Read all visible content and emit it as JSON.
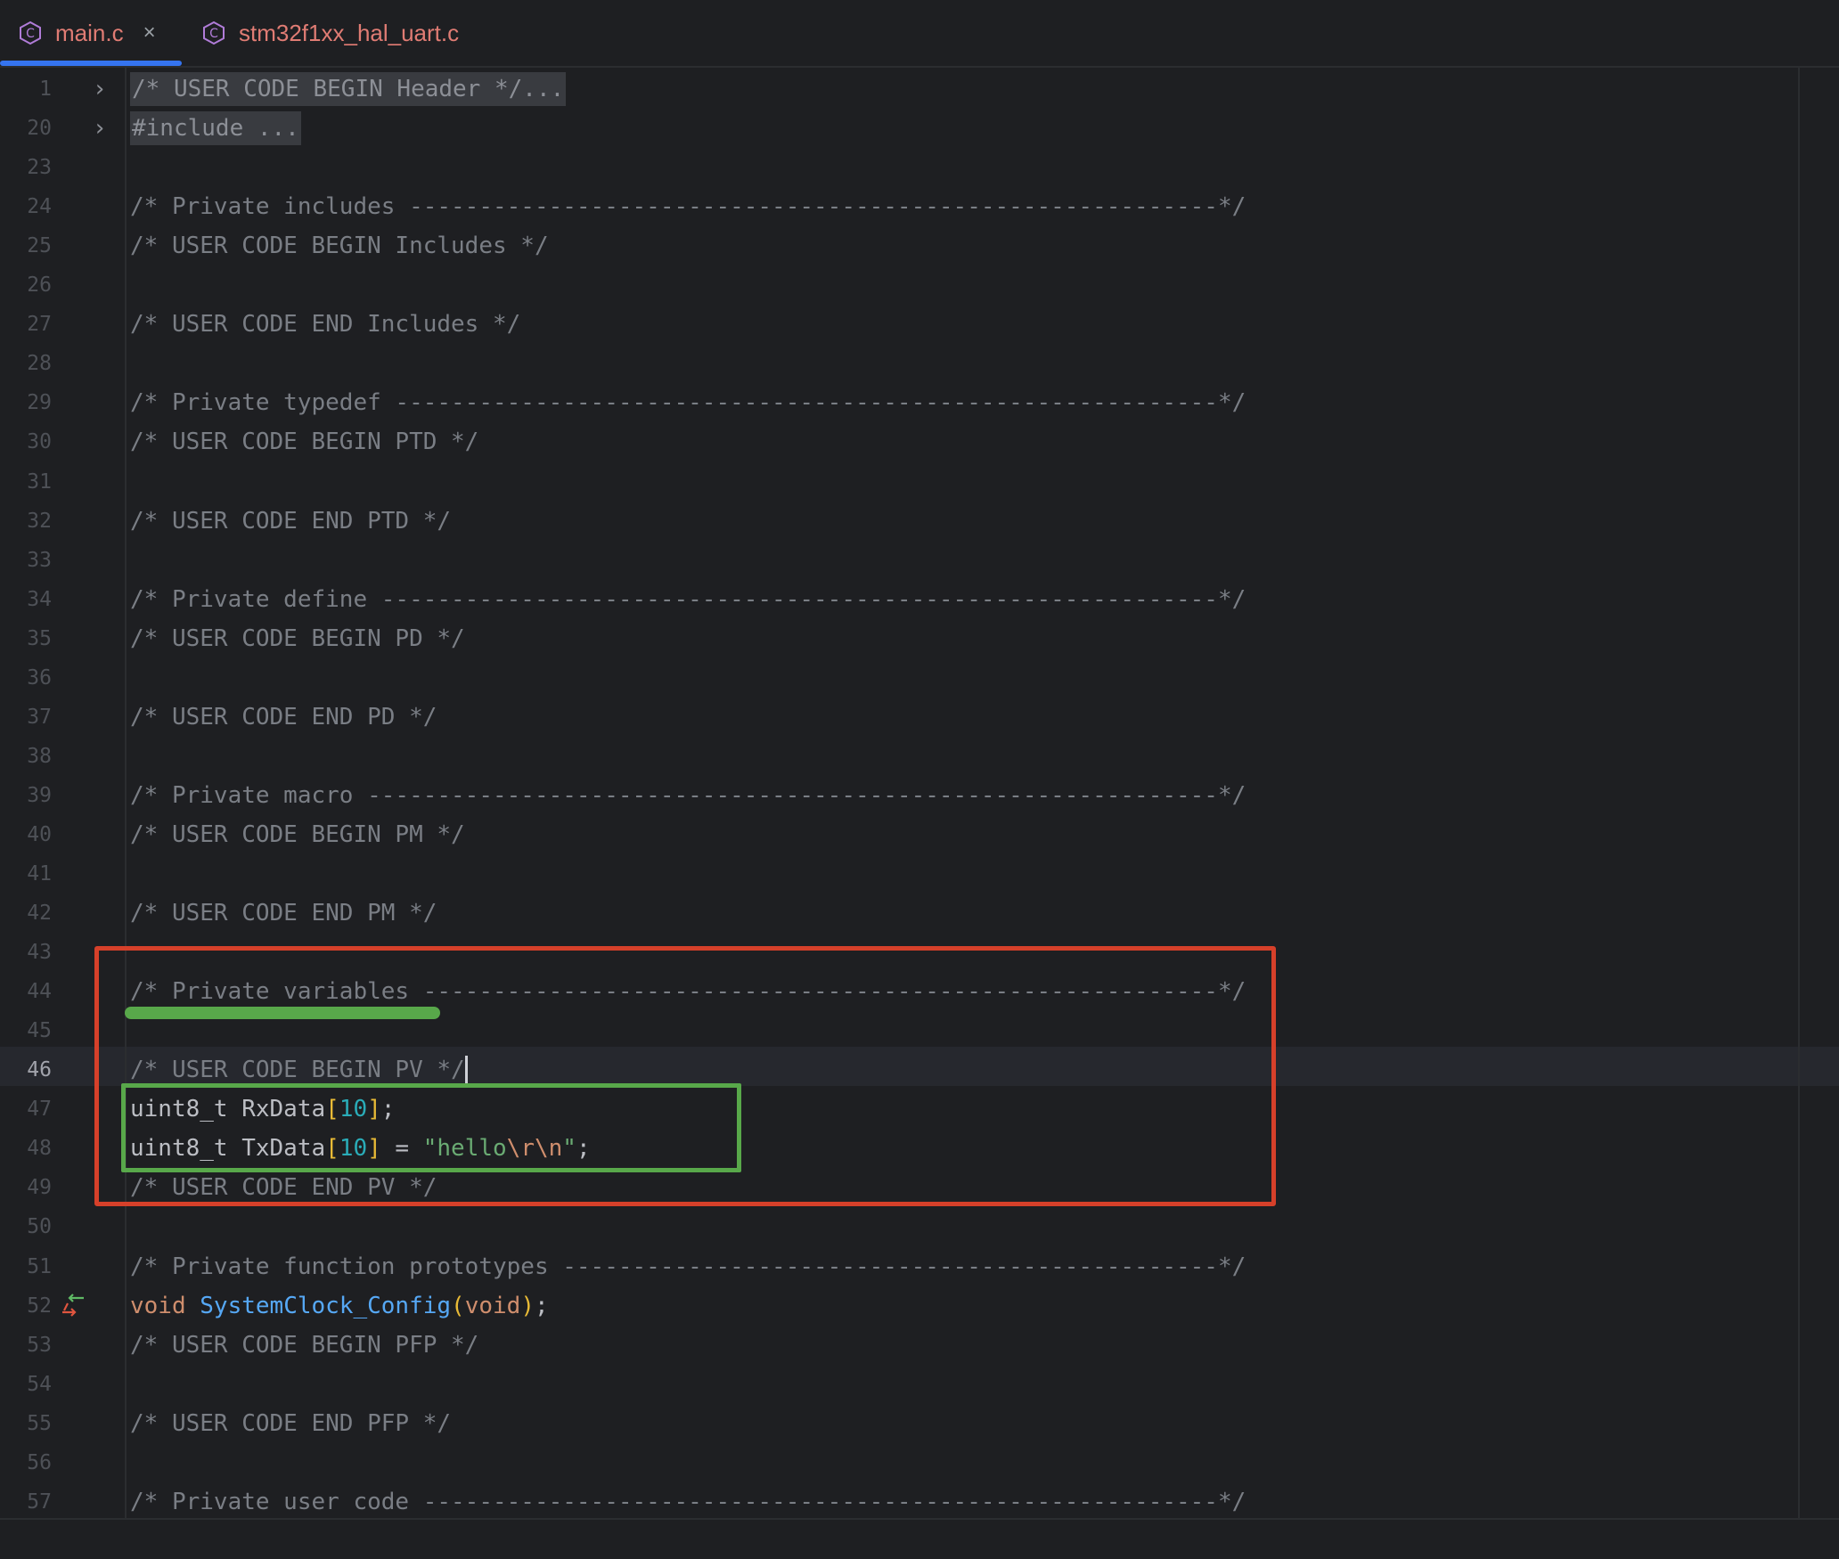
{
  "tabs": [
    {
      "label": "main.c",
      "close": "×",
      "active": true
    },
    {
      "label": "stm32f1xx_hal_uart.c",
      "active": false
    }
  ],
  "colors": {
    "tab_text": "#e07c74",
    "tab_icon": "#b07cd8",
    "active_underline": "#3574f0",
    "red_box": "#d6402a",
    "green_mark": "#58a84a"
  },
  "icons": {
    "fold": "chevron-right-icon",
    "file_type": "c-file-icon",
    "implementation": "implementation-arrows-icon"
  },
  "lines": [
    {
      "n": "1",
      "text": "/* USER CODE BEGIN Header */..."
    },
    {
      "n": "20",
      "text": "#include ..."
    },
    {
      "n": "23",
      "text": ""
    },
    {
      "n": "24",
      "text": "/* Private includes ----------------------------------------------------------*/"
    },
    {
      "n": "25",
      "text": "/* USER CODE BEGIN Includes */"
    },
    {
      "n": "26",
      "text": ""
    },
    {
      "n": "27",
      "text": "/* USER CODE END Includes */"
    },
    {
      "n": "28",
      "text": ""
    },
    {
      "n": "29",
      "text": "/* Private typedef -----------------------------------------------------------*/"
    },
    {
      "n": "30",
      "text": "/* USER CODE BEGIN PTD */"
    },
    {
      "n": "31",
      "text": ""
    },
    {
      "n": "32",
      "text": "/* USER CODE END PTD */"
    },
    {
      "n": "33",
      "text": ""
    },
    {
      "n": "34",
      "text": "/* Private define ------------------------------------------------------------*/"
    },
    {
      "n": "35",
      "text": "/* USER CODE BEGIN PD */"
    },
    {
      "n": "36",
      "text": ""
    },
    {
      "n": "37",
      "text": "/* USER CODE END PD */"
    },
    {
      "n": "38",
      "text": ""
    },
    {
      "n": "39",
      "text": "/* Private macro -------------------------------------------------------------*/"
    },
    {
      "n": "40",
      "text": "/* USER CODE BEGIN PM */"
    },
    {
      "n": "41",
      "text": ""
    },
    {
      "n": "42",
      "text": "/* USER CODE END PM */"
    },
    {
      "n": "43",
      "text": ""
    },
    {
      "n": "44",
      "text": "/* Private variables ---------------------------------------------------------*/"
    },
    {
      "n": "45",
      "text": ""
    },
    {
      "n": "46",
      "text": "/* USER CODE BEGIN PV */"
    },
    {
      "n": "47",
      "parts": [
        "uint8_t RxData",
        "[",
        "10",
        "]",
        ";"
      ]
    },
    {
      "n": "48",
      "parts": [
        "uint8_t TxData",
        "[",
        "10",
        "]",
        " = ",
        "\"hello",
        "\\r\\n",
        "\"",
        ";"
      ]
    },
    {
      "n": "49",
      "text": "/* USER CODE END PV */"
    },
    {
      "n": "50",
      "text": ""
    },
    {
      "n": "51",
      "text": "/* Private function prototypes -----------------------------------------------*/"
    },
    {
      "n": "52",
      "parts": [
        "void",
        " ",
        "SystemClock_Config",
        "(",
        "void",
        ")",
        ";"
      ]
    },
    {
      "n": "53",
      "text": "/* USER CODE BEGIN PFP */"
    },
    {
      "n": "54",
      "text": ""
    },
    {
      "n": "55",
      "text": "/* USER CODE END PFP */"
    },
    {
      "n": "56",
      "text": ""
    },
    {
      "n": "57",
      "text": "/* Private user code ---------------------------------------------------------*/"
    }
  ],
  "fold_marker": "›",
  "current_line": "46"
}
